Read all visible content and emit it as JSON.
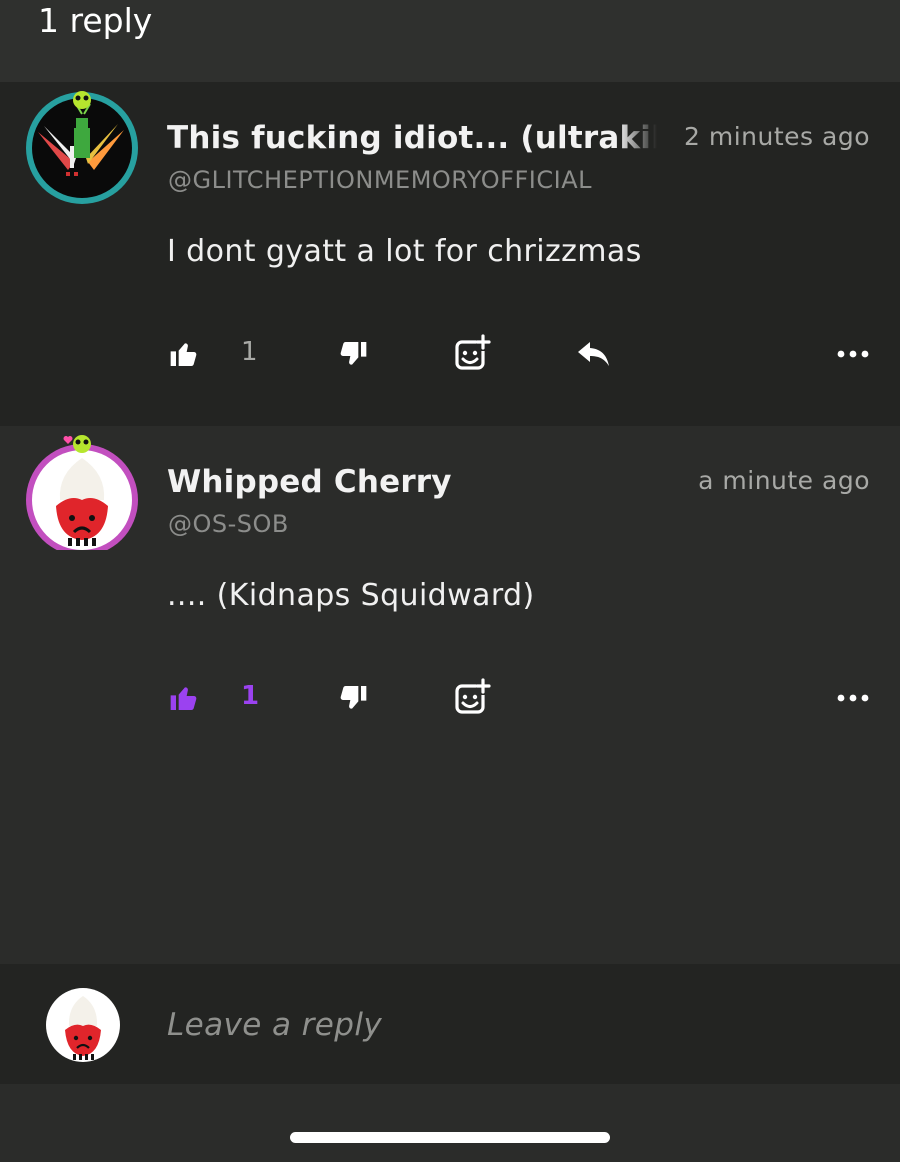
{
  "header": {
    "title": "1 reply"
  },
  "comments": [
    {
      "name": "This fucking idiot... (ultrakill a",
      "handle": "@GLITCHEPTIONMEMORYOFFICIAL",
      "time": "2 minutes ago",
      "body": "I dont gyatt a lot for chrizzmas",
      "like_count": "1",
      "liked": false
    },
    {
      "name": "Whipped Cherry",
      "handle": "@OS-SOB",
      "time": "a minute ago",
      "body": ".... (Kidnaps Squidward)",
      "like_count": "1",
      "liked": true
    }
  ],
  "composer": {
    "placeholder": "Leave a reply"
  },
  "colors": {
    "accent": "#9b42f0",
    "icon": "#ffffff",
    "background": "#2b2c2a",
    "panel": "#232422"
  },
  "icons": [
    "thumbs-up-icon",
    "thumbs-down-icon",
    "add-reaction-icon",
    "reply-icon",
    "more-icon"
  ]
}
